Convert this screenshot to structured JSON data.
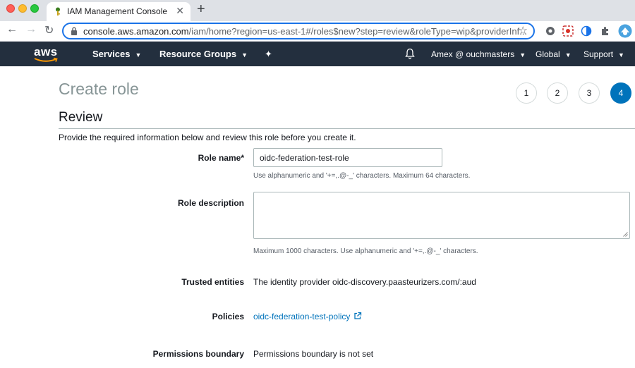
{
  "browser": {
    "tab_title": "IAM Management Console",
    "url_host": "console.aws.amazon.com",
    "url_path": "/iam/home?region=us-east-1#/roles$new?step=review&roleType=wip&providerInf..."
  },
  "aws_nav": {
    "logo": "aws",
    "services": "Services",
    "resource_groups": "Resource Groups",
    "account": "Amex @ ouchmasters",
    "region": "Global",
    "support": "Support"
  },
  "page": {
    "title": "Create role",
    "steps": [
      "1",
      "2",
      "3",
      "4"
    ],
    "active_step": 4,
    "section_title": "Review",
    "intro": "Provide the required information below and review this role before you create it."
  },
  "form": {
    "role_name_label": "Role name*",
    "role_name_value": "oidc-federation-test-role",
    "role_name_hint": "Use alphanumeric and '+=,.@-_' characters. Maximum 64 characters.",
    "role_description_label": "Role description",
    "role_description_value": "",
    "role_description_hint": "Maximum 1000 characters. Use alphanumeric and '+=,.@-_' characters.",
    "trusted_entities_label": "Trusted entities",
    "trusted_entities_value": "The identity provider oidc-discovery.paasteurizers.com/:aud",
    "policies_label": "Policies",
    "policies_value": "oidc-federation-test-policy",
    "permissions_boundary_label": "Permissions boundary",
    "permissions_boundary_value": "Permissions boundary is not set"
  },
  "colors": {
    "aws_nav_bg": "#232f3e",
    "accent_blue": "#0073bb",
    "title_gray": "#879596"
  }
}
